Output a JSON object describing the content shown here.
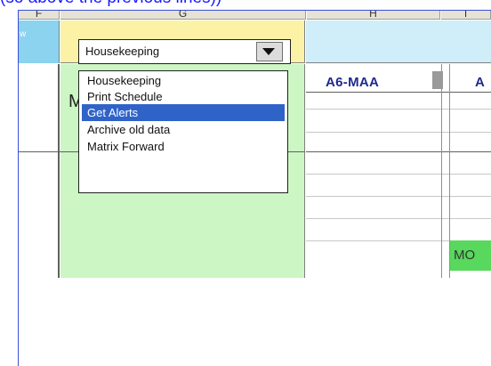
{
  "caption": "(so above the previous lines))",
  "columns": {
    "f": "F",
    "g": "G",
    "h": "H",
    "i": "I"
  },
  "left_cell_label": "w",
  "green_cell_text": "M",
  "dropdown": {
    "value": "Housekeeping",
    "items": [
      "Housekeeping",
      "Print Schedule",
      "Get Alerts",
      "Archive old data",
      "Matrix Forward"
    ],
    "selected_index": 2
  },
  "grid": {
    "a6_label": "A6-MAA",
    "a_label": "A",
    "mo_label": "MO"
  },
  "colors": {
    "selection": "#2f63c8",
    "green": "#ccf6c4",
    "yellow": "#fbf2a6",
    "frame": "#3a4fd6",
    "mo_green": "#58d85c"
  }
}
